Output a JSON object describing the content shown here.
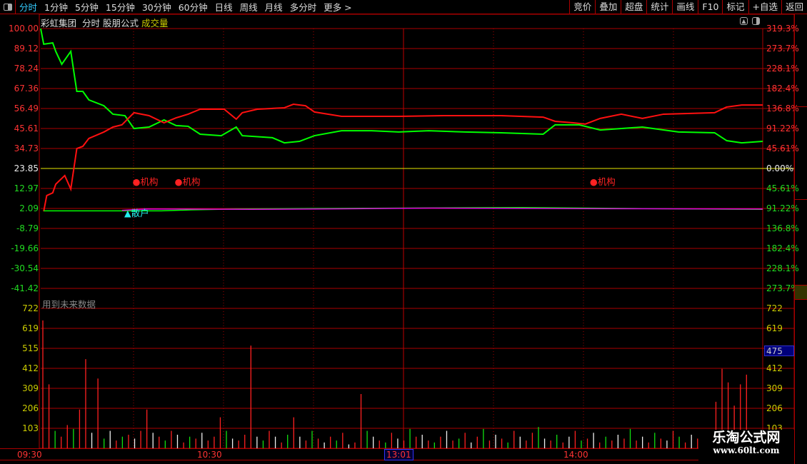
{
  "topbar": {
    "periods": [
      "分时",
      "1分钟",
      "5分钟",
      "15分钟",
      "30分钟",
      "60分钟",
      "日线",
      "周线",
      "月线",
      "多分时",
      "更多 >"
    ],
    "active": 0,
    "right_buttons": [
      "竞价",
      "叠加",
      "超盘",
      "统计",
      "画线",
      "F10",
      "标记",
      "+自选",
      "返回"
    ]
  },
  "subtitle": {
    "stock": "彩虹集团",
    "mode": "分时",
    "formula": "股朋公式",
    "indicator": "成交量"
  },
  "left_axis": [
    {
      "v": "100.00",
      "c": "red"
    },
    {
      "v": "89.12",
      "c": "red"
    },
    {
      "v": "78.24",
      "c": "red"
    },
    {
      "v": "67.36",
      "c": "red"
    },
    {
      "v": "56.49",
      "c": "red"
    },
    {
      "v": "45.61",
      "c": "red"
    },
    {
      "v": "34.73",
      "c": "red"
    },
    {
      "v": "23.85",
      "c": "wht"
    },
    {
      "v": "12.97",
      "c": "grn"
    },
    {
      "v": "2.09",
      "c": "grn"
    },
    {
      "v": "-8.79",
      "c": "grn"
    },
    {
      "v": "-19.66",
      "c": "grn"
    },
    {
      "v": "-30.54",
      "c": "grn"
    },
    {
      "v": "-41.42",
      "c": "grn"
    }
  ],
  "right_axis": [
    {
      "v": "319.3%",
      "c": "red"
    },
    {
      "v": "273.7%",
      "c": "red"
    },
    {
      "v": "228.1%",
      "c": "red"
    },
    {
      "v": "182.4%",
      "c": "red"
    },
    {
      "v": "136.8%",
      "c": "red"
    },
    {
      "v": "91.22%",
      "c": "red"
    },
    {
      "v": "45.61%",
      "c": "red"
    },
    {
      "v": "0.00%",
      "c": "wht"
    },
    {
      "v": "45.61%",
      "c": "grn"
    },
    {
      "v": "91.22%",
      "c": "grn"
    },
    {
      "v": "136.8%",
      "c": "grn"
    },
    {
      "v": "182.4%",
      "c": "grn"
    },
    {
      "v": "228.1%",
      "c": "grn"
    },
    {
      "v": "273.7%",
      "c": "grn"
    }
  ],
  "vol_axis": [
    "722",
    "619",
    "515",
    "412",
    "309",
    "206",
    "103"
  ],
  "vol_cursor": "475",
  "future_warning": "用到未来数据",
  "markers": [
    {
      "t": "●机构",
      "minute": 31
    },
    {
      "t": "●机构",
      "minute": 45
    },
    {
      "t": "●机构",
      "minute": 183
    }
  ],
  "marker_retail": "▲散户",
  "time_labels": [
    "09:30",
    "10:30",
    "13:01",
    "14:00"
  ],
  "watermark": {
    "name": "乐淘公式网",
    "url": "www.60lt.com"
  },
  "chart_data": {
    "type": "line",
    "x_unit": "minute",
    "xlim": [
      0,
      240
    ],
    "ylim": [
      -52.3,
      100
    ],
    "baseline": 23.85,
    "vol_max": 722,
    "colors": {
      "green": "#00ff00",
      "red": "#ff1010",
      "magenta": "#e000e0",
      "baseline": "#e8e800"
    },
    "series": [
      {
        "name": "green",
        "points": [
          [
            0,
            100
          ],
          [
            1,
            91.5
          ],
          [
            4,
            92.2
          ],
          [
            5,
            87.6
          ],
          [
            7,
            80.6
          ],
          [
            10,
            87.6
          ],
          [
            12,
            65.8
          ],
          [
            14,
            65.8
          ],
          [
            16,
            61.2
          ],
          [
            21,
            58
          ],
          [
            24,
            53.4
          ],
          [
            28,
            52.6
          ],
          [
            31,
            45.6
          ],
          [
            36,
            46.4
          ],
          [
            41,
            50.3
          ],
          [
            45,
            47.2
          ],
          [
            49,
            46.8
          ],
          [
            53,
            42.5
          ],
          [
            60,
            41.7
          ],
          [
            65,
            46.4
          ],
          [
            67,
            41.7
          ],
          [
            77,
            40.6
          ],
          [
            81,
            37.8
          ],
          [
            86,
            38.6
          ],
          [
            91,
            41.7
          ],
          [
            100,
            44.4
          ],
          [
            110,
            44.4
          ],
          [
            119,
            43.7
          ],
          [
            129,
            44.4
          ],
          [
            141,
            43.7
          ],
          [
            153,
            43.3
          ],
          [
            167,
            42.5
          ],
          [
            171,
            47.6
          ],
          [
            179,
            47.6
          ],
          [
            186,
            44.8
          ],
          [
            200,
            46.4
          ],
          [
            212,
            43.7
          ],
          [
            224,
            43.3
          ],
          [
            228,
            39
          ],
          [
            233,
            37.8
          ],
          [
            240,
            38.6
          ]
        ]
      },
      {
        "name": "red",
        "points": [
          [
            1,
            0.5
          ],
          [
            2,
            9.1
          ],
          [
            4,
            10.6
          ],
          [
            5,
            15.3
          ],
          [
            8,
            20
          ],
          [
            10,
            12.6
          ],
          [
            12,
            34.7
          ],
          [
            14,
            35.9
          ],
          [
            16,
            40.2
          ],
          [
            21,
            43.7
          ],
          [
            24,
            46.4
          ],
          [
            27,
            47.6
          ],
          [
            31,
            54.2
          ],
          [
            36,
            52.6
          ],
          [
            41,
            48.7
          ],
          [
            45,
            51.4
          ],
          [
            49,
            53.4
          ],
          [
            53,
            56.1
          ],
          [
            61,
            56.1
          ],
          [
            65,
            50.7
          ],
          [
            67,
            54.2
          ],
          [
            72,
            56.1
          ],
          [
            81,
            56.9
          ],
          [
            84,
            58.8
          ],
          [
            88,
            58
          ],
          [
            91,
            54.6
          ],
          [
            100,
            52.2
          ],
          [
            119,
            52.2
          ],
          [
            134,
            52.6
          ],
          [
            153,
            52.6
          ],
          [
            167,
            51.8
          ],
          [
            171,
            49.5
          ],
          [
            177,
            48.7
          ],
          [
            181,
            48
          ],
          [
            186,
            51.1
          ],
          [
            193,
            53.4
          ],
          [
            200,
            51.1
          ],
          [
            207,
            53.4
          ],
          [
            224,
            54.2
          ],
          [
            228,
            57.3
          ],
          [
            233,
            58.4
          ],
          [
            240,
            58.4
          ]
        ]
      },
      {
        "name": "green-low",
        "points": [
          [
            1,
            0.8
          ],
          [
            40,
            0.8
          ],
          [
            50,
            1.3
          ],
          [
            65,
            1.8
          ],
          [
            110,
            2.2
          ],
          [
            160,
            2.6
          ],
          [
            200,
            2.0
          ],
          [
            240,
            1.6
          ]
        ]
      },
      {
        "name": "magenta",
        "points": [
          [
            27,
            1.0
          ],
          [
            35,
            1.8
          ],
          [
            70,
            1.6
          ],
          [
            100,
            1.9
          ],
          [
            130,
            2.3
          ],
          [
            180,
            2.0
          ],
          [
            240,
            1.8
          ]
        ]
      }
    ],
    "volume": [
      [
        660,
        "r"
      ],
      [
        330,
        "r"
      ],
      [
        90,
        "g"
      ],
      [
        60,
        "r"
      ],
      [
        120,
        "r"
      ],
      [
        100,
        "g"
      ],
      [
        200,
        "r"
      ],
      [
        460,
        "r"
      ],
      [
        80,
        "w"
      ],
      [
        360,
        "r"
      ],
      [
        50,
        "g"
      ],
      [
        90,
        "w"
      ],
      [
        40,
        "r"
      ],
      [
        60,
        "g"
      ],
      [
        70,
        "r"
      ],
      [
        50,
        "w"
      ],
      [
        90,
        "r"
      ],
      [
        200,
        "r"
      ],
      [
        80,
        "w"
      ],
      [
        60,
        "r"
      ],
      [
        40,
        "g"
      ],
      [
        90,
        "r"
      ],
      [
        70,
        "w"
      ],
      [
        30,
        "r"
      ],
      [
        60,
        "g"
      ],
      [
        50,
        "r"
      ],
      [
        80,
        "w"
      ],
      [
        40,
        "r"
      ],
      [
        60,
        "r"
      ],
      [
        160,
        "r"
      ],
      [
        90,
        "g"
      ],
      [
        50,
        "w"
      ],
      [
        40,
        "r"
      ],
      [
        70,
        "r"
      ],
      [
        530,
        "r"
      ],
      [
        60,
        "w"
      ],
      [
        40,
        "g"
      ],
      [
        90,
        "r"
      ],
      [
        60,
        "w"
      ],
      [
        30,
        "r"
      ],
      [
        70,
        "g"
      ],
      [
        160,
        "r"
      ],
      [
        60,
        "w"
      ],
      [
        40,
        "r"
      ],
      [
        90,
        "g"
      ],
      [
        50,
        "r"
      ],
      [
        30,
        "w"
      ],
      [
        60,
        "r"
      ],
      [
        40,
        "g"
      ],
      [
        80,
        "r"
      ],
      [
        20,
        "w"
      ],
      [
        30,
        "r"
      ],
      [
        280,
        "r"
      ],
      [
        90,
        "g"
      ],
      [
        60,
        "w"
      ],
      [
        40,
        "r"
      ],
      [
        30,
        "g"
      ],
      [
        80,
        "r"
      ],
      [
        50,
        "w"
      ],
      [
        40,
        "r"
      ],
      [
        100,
        "g"
      ],
      [
        60,
        "r"
      ],
      [
        70,
        "w"
      ],
      [
        40,
        "r"
      ],
      [
        30,
        "g"
      ],
      [
        60,
        "r"
      ],
      [
        90,
        "w"
      ],
      [
        40,
        "r"
      ],
      [
        50,
        "g"
      ],
      [
        80,
        "r"
      ],
      [
        30,
        "w"
      ],
      [
        60,
        "r"
      ],
      [
        100,
        "g"
      ],
      [
        40,
        "r"
      ],
      [
        70,
        "w"
      ],
      [
        50,
        "r"
      ],
      [
        30,
        "g"
      ],
      [
        90,
        "r"
      ],
      [
        60,
        "w"
      ],
      [
        40,
        "r"
      ],
      [
        80,
        "r"
      ],
      [
        110,
        "g"
      ],
      [
        50,
        "w"
      ],
      [
        40,
        "r"
      ],
      [
        70,
        "g"
      ],
      [
        30,
        "r"
      ],
      [
        60,
        "w"
      ],
      [
        90,
        "r"
      ],
      [
        40,
        "g"
      ],
      [
        50,
        "r"
      ],
      [
        80,
        "w"
      ],
      [
        30,
        "r"
      ],
      [
        60,
        "g"
      ],
      [
        40,
        "r"
      ],
      [
        70,
        "w"
      ],
      [
        50,
        "r"
      ],
      [
        100,
        "g"
      ],
      [
        40,
        "r"
      ],
      [
        60,
        "w"
      ],
      [
        30,
        "r"
      ],
      [
        80,
        "g"
      ],
      [
        50,
        "r"
      ],
      [
        40,
        "w"
      ],
      [
        90,
        "r"
      ],
      [
        60,
        "g"
      ],
      [
        30,
        "r"
      ],
      [
        70,
        "w"
      ],
      [
        50,
        "r"
      ],
      [
        0,
        "w"
      ],
      [
        0,
        "w"
      ],
      [
        240,
        "r"
      ],
      [
        410,
        "r"
      ],
      [
        340,
        "r"
      ],
      [
        220,
        "r"
      ],
      [
        330,
        "r"
      ],
      [
        380,
        "r"
      ],
      [
        60,
        "w"
      ],
      [
        40,
        "r"
      ]
    ]
  }
}
